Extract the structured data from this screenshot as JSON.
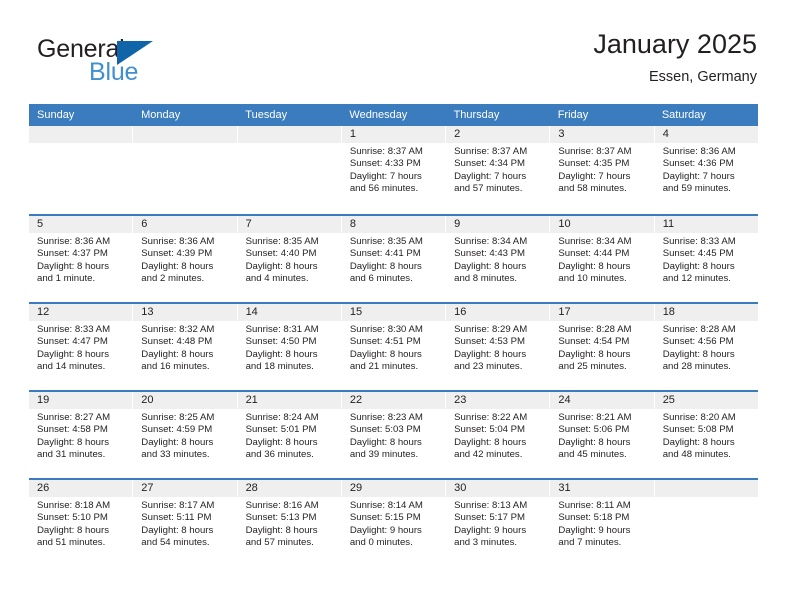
{
  "brand": {
    "name_top": "General",
    "name_bottom": "Blue",
    "triangle_color": "#1064a8",
    "blue_color": "#3f8fd2"
  },
  "header": {
    "title": "January 2025",
    "subtitle": "Essen, Germany"
  },
  "theme": {
    "header_blue": "#3a7cbe",
    "day_strip_gray": "#efeff0",
    "text": "#231f20"
  },
  "weekdays": [
    "Sunday",
    "Monday",
    "Tuesday",
    "Wednesday",
    "Thursday",
    "Friday",
    "Saturday"
  ],
  "labels": {
    "sunrise_prefix": "Sunrise:",
    "sunset_prefix": "Sunset:",
    "daylight_prefix": "Daylight:"
  },
  "weeks": [
    [
      {
        "day": "",
        "sunrise": "",
        "sunset": "",
        "daylight_a": "",
        "daylight_b": ""
      },
      {
        "day": "",
        "sunrise": "",
        "sunset": "",
        "daylight_a": "",
        "daylight_b": ""
      },
      {
        "day": "",
        "sunrise": "",
        "sunset": "",
        "daylight_a": "",
        "daylight_b": ""
      },
      {
        "day": "1",
        "sunrise": "Sunrise: 8:37 AM",
        "sunset": "Sunset: 4:33 PM",
        "daylight_a": "Daylight: 7 hours",
        "daylight_b": "and 56 minutes."
      },
      {
        "day": "2",
        "sunrise": "Sunrise: 8:37 AM",
        "sunset": "Sunset: 4:34 PM",
        "daylight_a": "Daylight: 7 hours",
        "daylight_b": "and 57 minutes."
      },
      {
        "day": "3",
        "sunrise": "Sunrise: 8:37 AM",
        "sunset": "Sunset: 4:35 PM",
        "daylight_a": "Daylight: 7 hours",
        "daylight_b": "and 58 minutes."
      },
      {
        "day": "4",
        "sunrise": "Sunrise: 8:36 AM",
        "sunset": "Sunset: 4:36 PM",
        "daylight_a": "Daylight: 7 hours",
        "daylight_b": "and 59 minutes."
      }
    ],
    [
      {
        "day": "5",
        "sunrise": "Sunrise: 8:36 AM",
        "sunset": "Sunset: 4:37 PM",
        "daylight_a": "Daylight: 8 hours",
        "daylight_b": "and 1 minute."
      },
      {
        "day": "6",
        "sunrise": "Sunrise: 8:36 AM",
        "sunset": "Sunset: 4:39 PM",
        "daylight_a": "Daylight: 8 hours",
        "daylight_b": "and 2 minutes."
      },
      {
        "day": "7",
        "sunrise": "Sunrise: 8:35 AM",
        "sunset": "Sunset: 4:40 PM",
        "daylight_a": "Daylight: 8 hours",
        "daylight_b": "and 4 minutes."
      },
      {
        "day": "8",
        "sunrise": "Sunrise: 8:35 AM",
        "sunset": "Sunset: 4:41 PM",
        "daylight_a": "Daylight: 8 hours",
        "daylight_b": "and 6 minutes."
      },
      {
        "day": "9",
        "sunrise": "Sunrise: 8:34 AM",
        "sunset": "Sunset: 4:43 PM",
        "daylight_a": "Daylight: 8 hours",
        "daylight_b": "and 8 minutes."
      },
      {
        "day": "10",
        "sunrise": "Sunrise: 8:34 AM",
        "sunset": "Sunset: 4:44 PM",
        "daylight_a": "Daylight: 8 hours",
        "daylight_b": "and 10 minutes."
      },
      {
        "day": "11",
        "sunrise": "Sunrise: 8:33 AM",
        "sunset": "Sunset: 4:45 PM",
        "daylight_a": "Daylight: 8 hours",
        "daylight_b": "and 12 minutes."
      }
    ],
    [
      {
        "day": "12",
        "sunrise": "Sunrise: 8:33 AM",
        "sunset": "Sunset: 4:47 PM",
        "daylight_a": "Daylight: 8 hours",
        "daylight_b": "and 14 minutes."
      },
      {
        "day": "13",
        "sunrise": "Sunrise: 8:32 AM",
        "sunset": "Sunset: 4:48 PM",
        "daylight_a": "Daylight: 8 hours",
        "daylight_b": "and 16 minutes."
      },
      {
        "day": "14",
        "sunrise": "Sunrise: 8:31 AM",
        "sunset": "Sunset: 4:50 PM",
        "daylight_a": "Daylight: 8 hours",
        "daylight_b": "and 18 minutes."
      },
      {
        "day": "15",
        "sunrise": "Sunrise: 8:30 AM",
        "sunset": "Sunset: 4:51 PM",
        "daylight_a": "Daylight: 8 hours",
        "daylight_b": "and 21 minutes."
      },
      {
        "day": "16",
        "sunrise": "Sunrise: 8:29 AM",
        "sunset": "Sunset: 4:53 PM",
        "daylight_a": "Daylight: 8 hours",
        "daylight_b": "and 23 minutes."
      },
      {
        "day": "17",
        "sunrise": "Sunrise: 8:28 AM",
        "sunset": "Sunset: 4:54 PM",
        "daylight_a": "Daylight: 8 hours",
        "daylight_b": "and 25 minutes."
      },
      {
        "day": "18",
        "sunrise": "Sunrise: 8:28 AM",
        "sunset": "Sunset: 4:56 PM",
        "daylight_a": "Daylight: 8 hours",
        "daylight_b": "and 28 minutes."
      }
    ],
    [
      {
        "day": "19",
        "sunrise": "Sunrise: 8:27 AM",
        "sunset": "Sunset: 4:58 PM",
        "daylight_a": "Daylight: 8 hours",
        "daylight_b": "and 31 minutes."
      },
      {
        "day": "20",
        "sunrise": "Sunrise: 8:25 AM",
        "sunset": "Sunset: 4:59 PM",
        "daylight_a": "Daylight: 8 hours",
        "daylight_b": "and 33 minutes."
      },
      {
        "day": "21",
        "sunrise": "Sunrise: 8:24 AM",
        "sunset": "Sunset: 5:01 PM",
        "daylight_a": "Daylight: 8 hours",
        "daylight_b": "and 36 minutes."
      },
      {
        "day": "22",
        "sunrise": "Sunrise: 8:23 AM",
        "sunset": "Sunset: 5:03 PM",
        "daylight_a": "Daylight: 8 hours",
        "daylight_b": "and 39 minutes."
      },
      {
        "day": "23",
        "sunrise": "Sunrise: 8:22 AM",
        "sunset": "Sunset: 5:04 PM",
        "daylight_a": "Daylight: 8 hours",
        "daylight_b": "and 42 minutes."
      },
      {
        "day": "24",
        "sunrise": "Sunrise: 8:21 AM",
        "sunset": "Sunset: 5:06 PM",
        "daylight_a": "Daylight: 8 hours",
        "daylight_b": "and 45 minutes."
      },
      {
        "day": "25",
        "sunrise": "Sunrise: 8:20 AM",
        "sunset": "Sunset: 5:08 PM",
        "daylight_a": "Daylight: 8 hours",
        "daylight_b": "and 48 minutes."
      }
    ],
    [
      {
        "day": "26",
        "sunrise": "Sunrise: 8:18 AM",
        "sunset": "Sunset: 5:10 PM",
        "daylight_a": "Daylight: 8 hours",
        "daylight_b": "and 51 minutes."
      },
      {
        "day": "27",
        "sunrise": "Sunrise: 8:17 AM",
        "sunset": "Sunset: 5:11 PM",
        "daylight_a": "Daylight: 8 hours",
        "daylight_b": "and 54 minutes."
      },
      {
        "day": "28",
        "sunrise": "Sunrise: 8:16 AM",
        "sunset": "Sunset: 5:13 PM",
        "daylight_a": "Daylight: 8 hours",
        "daylight_b": "and 57 minutes."
      },
      {
        "day": "29",
        "sunrise": "Sunrise: 8:14 AM",
        "sunset": "Sunset: 5:15 PM",
        "daylight_a": "Daylight: 9 hours",
        "daylight_b": "and 0 minutes."
      },
      {
        "day": "30",
        "sunrise": "Sunrise: 8:13 AM",
        "sunset": "Sunset: 5:17 PM",
        "daylight_a": "Daylight: 9 hours",
        "daylight_b": "and 3 minutes."
      },
      {
        "day": "31",
        "sunrise": "Sunrise: 8:11 AM",
        "sunset": "Sunset: 5:18 PM",
        "daylight_a": "Daylight: 9 hours",
        "daylight_b": "and 7 minutes."
      },
      {
        "day": "",
        "sunrise": "",
        "sunset": "",
        "daylight_a": "",
        "daylight_b": ""
      }
    ]
  ]
}
